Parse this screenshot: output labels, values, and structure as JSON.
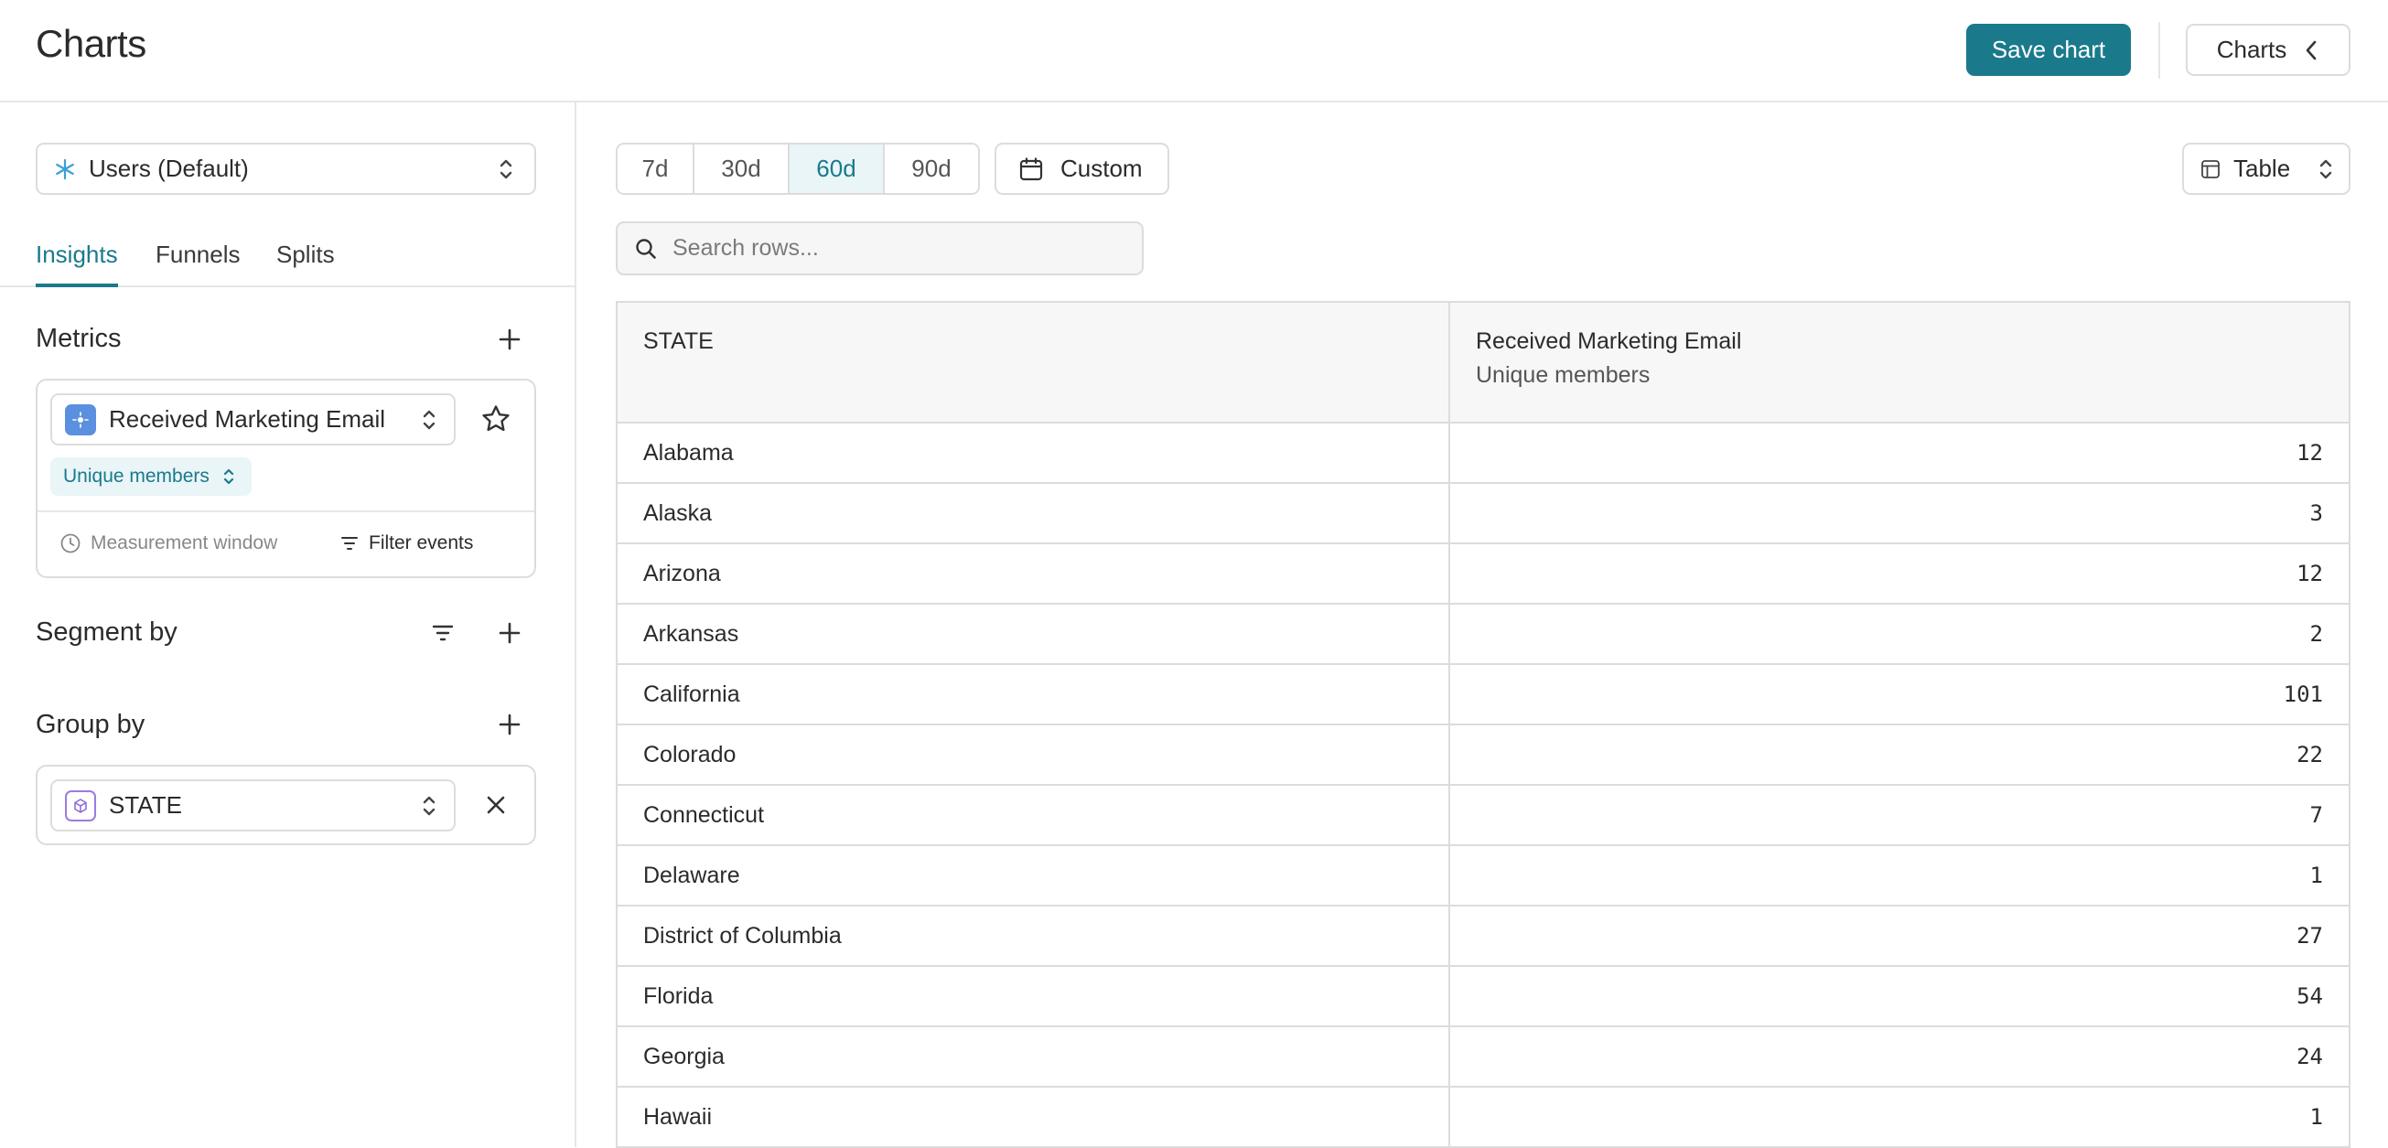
{
  "header": {
    "title": "Charts",
    "save_label": "Save chart",
    "charts_label": "Charts"
  },
  "sidebar": {
    "source_label": "Users (Default)",
    "tabs": [
      {
        "label": "Insights",
        "active": true
      },
      {
        "label": "Funnels",
        "active": false
      },
      {
        "label": "Splits",
        "active": false
      }
    ],
    "metrics": {
      "title": "Metrics",
      "metric_label": "Received Marketing Email",
      "aggregation_label": "Unique members",
      "measurement_window_label": "Measurement window",
      "filter_events_label": "Filter events"
    },
    "segment_title": "Segment by",
    "group": {
      "title": "Group by",
      "property_label": "STATE"
    }
  },
  "main": {
    "ranges": [
      {
        "label": "7d",
        "active": false
      },
      {
        "label": "30d",
        "active": false
      },
      {
        "label": "60d",
        "active": true
      },
      {
        "label": "90d",
        "active": false
      }
    ],
    "custom_label": "Custom",
    "view_label": "Table",
    "search_placeholder": "Search rows...",
    "table": {
      "col1": "STATE",
      "col2_title": "Received Marketing Email",
      "col2_sub": "Unique members",
      "rows": [
        {
          "state": "Alabama",
          "value": "12"
        },
        {
          "state": "Alaska",
          "value": "3"
        },
        {
          "state": "Arizona",
          "value": "12"
        },
        {
          "state": "Arkansas",
          "value": "2"
        },
        {
          "state": "California",
          "value": "101"
        },
        {
          "state": "Colorado",
          "value": "22"
        },
        {
          "state": "Connecticut",
          "value": "7"
        },
        {
          "state": "Delaware",
          "value": "1"
        },
        {
          "state": "District of Columbia",
          "value": "27"
        },
        {
          "state": "Florida",
          "value": "54"
        },
        {
          "state": "Georgia",
          "value": "24"
        },
        {
          "state": "Hawaii",
          "value": "1"
        }
      ]
    }
  },
  "colors": {
    "accent": "#1a7a8c",
    "accent_bg": "#e9f5f7",
    "border": "#dcdcdc"
  }
}
